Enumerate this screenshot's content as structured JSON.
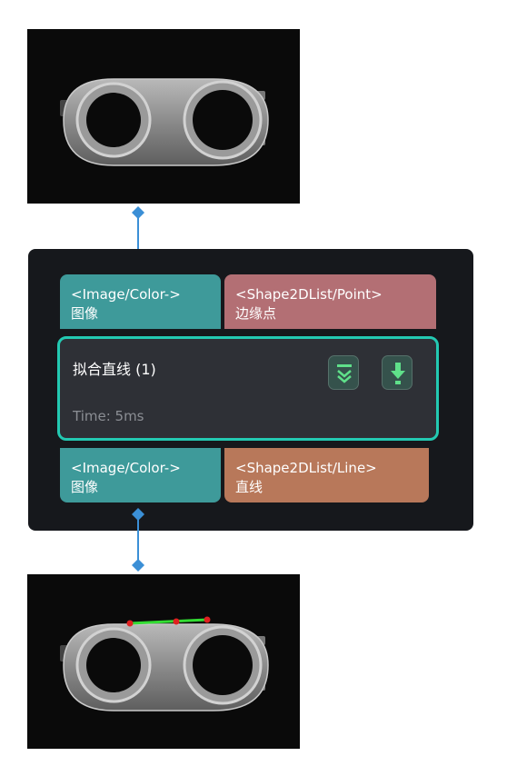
{
  "node": {
    "title": "拟合直线 (1)",
    "time": "Time: 5ms",
    "inputs": [
      {
        "type": "<Image/Color->",
        "name": "图像",
        "color": "#3e9a9a"
      },
      {
        "type": "<Shape2DList/Point>",
        "name": "边缘点",
        "color": "#b36f74"
      }
    ],
    "outputs": [
      {
        "type": "<Image/Color->",
        "name": "图像",
        "color": "#3e9a9a"
      },
      {
        "type": "<Shape2DList/Line>",
        "name": "直线",
        "color": "#b8785a"
      }
    ],
    "border_color": "#23c9b2",
    "buttons": [
      {
        "icon": "double-chevron-down-icon"
      },
      {
        "icon": "download-arrow-icon"
      }
    ]
  },
  "images": {
    "input_preview": "grayscale part image",
    "output_preview": "grayscale part image with fitted line",
    "line_color": "#33dd33",
    "point_color": "#e02020"
  },
  "connector_color": "#3b8fd6"
}
